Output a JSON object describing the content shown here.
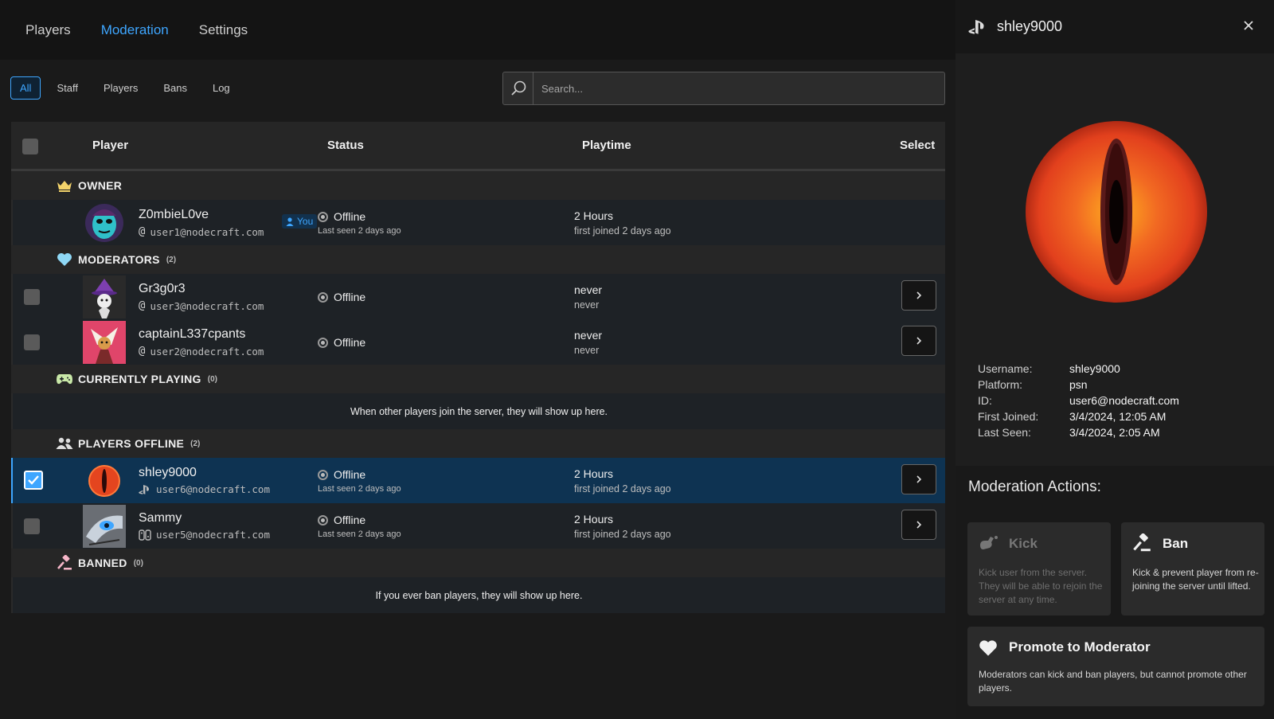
{
  "nav": {
    "tabs": [
      "Players",
      "Moderation",
      "Settings"
    ],
    "active": "Moderation"
  },
  "filters": {
    "chips": [
      "All",
      "Staff",
      "Players",
      "Bans",
      "Log"
    ],
    "active": "All"
  },
  "search": {
    "placeholder": "Search..."
  },
  "table": {
    "headers": {
      "player": "Player",
      "status": "Status",
      "playtime": "Playtime",
      "select": "Select"
    }
  },
  "groups": {
    "owner": {
      "title": "OWNER"
    },
    "moderators": {
      "title": "MODERATORS",
      "count": "(2)"
    },
    "playing": {
      "title": "CURRENTLY PLAYING",
      "count": "(0)",
      "empty": "When other players join the server, they will show up here."
    },
    "offline": {
      "title": "PLAYERS OFFLINE",
      "count": "(2)"
    },
    "banned": {
      "title": "BANNED",
      "count": "(0)",
      "empty": "If you ever ban players, they will show up here."
    }
  },
  "players": {
    "owner": {
      "name": "Z0mbieL0ve",
      "email": "user1@nodecraft.com",
      "badge": "You",
      "status": "Offline",
      "last_seen": "Last seen 2 days ago",
      "playtime": "2 Hours",
      "joined": "first joined 2 days ago"
    },
    "mod1": {
      "name": "Gr3g0r3",
      "email": "user3@nodecraft.com",
      "status": "Offline",
      "playtime": "never",
      "joined": "never"
    },
    "mod2": {
      "name": "captainL337cpants",
      "email": "user2@nodecraft.com",
      "status": "Offline",
      "playtime": "never",
      "joined": "never"
    },
    "off1": {
      "name": "shley9000",
      "email": "user6@nodecraft.com",
      "status": "Offline",
      "last_seen": "Last seen 2 days ago",
      "playtime": "2 Hours",
      "joined": "first joined 2 days ago"
    },
    "off2": {
      "name": "Sammy",
      "email": "user5@nodecraft.com",
      "status": "Offline",
      "last_seen": "Last seen 2 days ago",
      "playtime": "2 Hours",
      "joined": "first joined 2 days ago"
    }
  },
  "panel": {
    "title": "shley9000",
    "info": [
      {
        "k": "Username:",
        "v": "shley9000"
      },
      {
        "k": "Platform:",
        "v": "psn"
      },
      {
        "k": "ID:",
        "v": "user6@nodecraft.com"
      },
      {
        "k": "First Joined:",
        "v": "3/4/2024, 12:05 AM"
      },
      {
        "k": "Last Seen:",
        "v": "3/4/2024, 2:05 AM"
      }
    ],
    "actions_title": "Moderation Actions:",
    "kick": {
      "title": "Kick",
      "desc": "Kick user from the server. They will be able to rejoin the server at any time."
    },
    "ban": {
      "title": "Ban",
      "desc": "Kick & prevent player from re-joining the server until lifted."
    },
    "promote": {
      "title": "Promote to Moderator",
      "desc": "Moderators can kick and ban players, but cannot promote other players."
    }
  },
  "colors": {
    "accent": "#3ea6ff",
    "selected_row": "#0e3352",
    "background": "#1a1a1a"
  }
}
